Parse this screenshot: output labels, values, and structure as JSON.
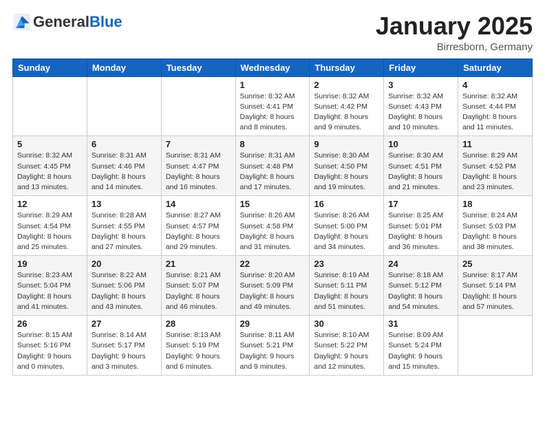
{
  "header": {
    "logo_general": "General",
    "logo_blue": "Blue",
    "month_title": "January 2025",
    "location": "Birresborn, Germany"
  },
  "weekdays": [
    "Sunday",
    "Monday",
    "Tuesday",
    "Wednesday",
    "Thursday",
    "Friday",
    "Saturday"
  ],
  "weeks": [
    [
      {
        "day": "",
        "info": ""
      },
      {
        "day": "",
        "info": ""
      },
      {
        "day": "",
        "info": ""
      },
      {
        "day": "1",
        "info": "Sunrise: 8:32 AM\nSunset: 4:41 PM\nDaylight: 8 hours\nand 8 minutes."
      },
      {
        "day": "2",
        "info": "Sunrise: 8:32 AM\nSunset: 4:42 PM\nDaylight: 8 hours\nand 9 minutes."
      },
      {
        "day": "3",
        "info": "Sunrise: 8:32 AM\nSunset: 4:43 PM\nDaylight: 8 hours\nand 10 minutes."
      },
      {
        "day": "4",
        "info": "Sunrise: 8:32 AM\nSunset: 4:44 PM\nDaylight: 8 hours\nand 11 minutes."
      }
    ],
    [
      {
        "day": "5",
        "info": "Sunrise: 8:32 AM\nSunset: 4:45 PM\nDaylight: 8 hours\nand 13 minutes."
      },
      {
        "day": "6",
        "info": "Sunrise: 8:31 AM\nSunset: 4:46 PM\nDaylight: 8 hours\nand 14 minutes."
      },
      {
        "day": "7",
        "info": "Sunrise: 8:31 AM\nSunset: 4:47 PM\nDaylight: 8 hours\nand 16 minutes."
      },
      {
        "day": "8",
        "info": "Sunrise: 8:31 AM\nSunset: 4:48 PM\nDaylight: 8 hours\nand 17 minutes."
      },
      {
        "day": "9",
        "info": "Sunrise: 8:30 AM\nSunset: 4:50 PM\nDaylight: 8 hours\nand 19 minutes."
      },
      {
        "day": "10",
        "info": "Sunrise: 8:30 AM\nSunset: 4:51 PM\nDaylight: 8 hours\nand 21 minutes."
      },
      {
        "day": "11",
        "info": "Sunrise: 8:29 AM\nSunset: 4:52 PM\nDaylight: 8 hours\nand 23 minutes."
      }
    ],
    [
      {
        "day": "12",
        "info": "Sunrise: 8:29 AM\nSunset: 4:54 PM\nDaylight: 8 hours\nand 25 minutes."
      },
      {
        "day": "13",
        "info": "Sunrise: 8:28 AM\nSunset: 4:55 PM\nDaylight: 8 hours\nand 27 minutes."
      },
      {
        "day": "14",
        "info": "Sunrise: 8:27 AM\nSunset: 4:57 PM\nDaylight: 8 hours\nand 29 minutes."
      },
      {
        "day": "15",
        "info": "Sunrise: 8:26 AM\nSunset: 4:58 PM\nDaylight: 8 hours\nand 31 minutes."
      },
      {
        "day": "16",
        "info": "Sunrise: 8:26 AM\nSunset: 5:00 PM\nDaylight: 8 hours\nand 34 minutes."
      },
      {
        "day": "17",
        "info": "Sunrise: 8:25 AM\nSunset: 5:01 PM\nDaylight: 8 hours\nand 36 minutes."
      },
      {
        "day": "18",
        "info": "Sunrise: 8:24 AM\nSunset: 5:03 PM\nDaylight: 8 hours\nand 38 minutes."
      }
    ],
    [
      {
        "day": "19",
        "info": "Sunrise: 8:23 AM\nSunset: 5:04 PM\nDaylight: 8 hours\nand 41 minutes."
      },
      {
        "day": "20",
        "info": "Sunrise: 8:22 AM\nSunset: 5:06 PM\nDaylight: 8 hours\nand 43 minutes."
      },
      {
        "day": "21",
        "info": "Sunrise: 8:21 AM\nSunset: 5:07 PM\nDaylight: 8 hours\nand 46 minutes."
      },
      {
        "day": "22",
        "info": "Sunrise: 8:20 AM\nSunset: 5:09 PM\nDaylight: 8 hours\nand 49 minutes."
      },
      {
        "day": "23",
        "info": "Sunrise: 8:19 AM\nSunset: 5:11 PM\nDaylight: 8 hours\nand 51 minutes."
      },
      {
        "day": "24",
        "info": "Sunrise: 8:18 AM\nSunset: 5:12 PM\nDaylight: 8 hours\nand 54 minutes."
      },
      {
        "day": "25",
        "info": "Sunrise: 8:17 AM\nSunset: 5:14 PM\nDaylight: 8 hours\nand 57 minutes."
      }
    ],
    [
      {
        "day": "26",
        "info": "Sunrise: 8:15 AM\nSunset: 5:16 PM\nDaylight: 9 hours\nand 0 minutes."
      },
      {
        "day": "27",
        "info": "Sunrise: 8:14 AM\nSunset: 5:17 PM\nDaylight: 9 hours\nand 3 minutes."
      },
      {
        "day": "28",
        "info": "Sunrise: 8:13 AM\nSunset: 5:19 PM\nDaylight: 9 hours\nand 6 minutes."
      },
      {
        "day": "29",
        "info": "Sunrise: 8:11 AM\nSunset: 5:21 PM\nDaylight: 9 hours\nand 9 minutes."
      },
      {
        "day": "30",
        "info": "Sunrise: 8:10 AM\nSunset: 5:22 PM\nDaylight: 9 hours\nand 12 minutes."
      },
      {
        "day": "31",
        "info": "Sunrise: 8:09 AM\nSunset: 5:24 PM\nDaylight: 9 hours\nand 15 minutes."
      },
      {
        "day": "",
        "info": ""
      }
    ]
  ]
}
